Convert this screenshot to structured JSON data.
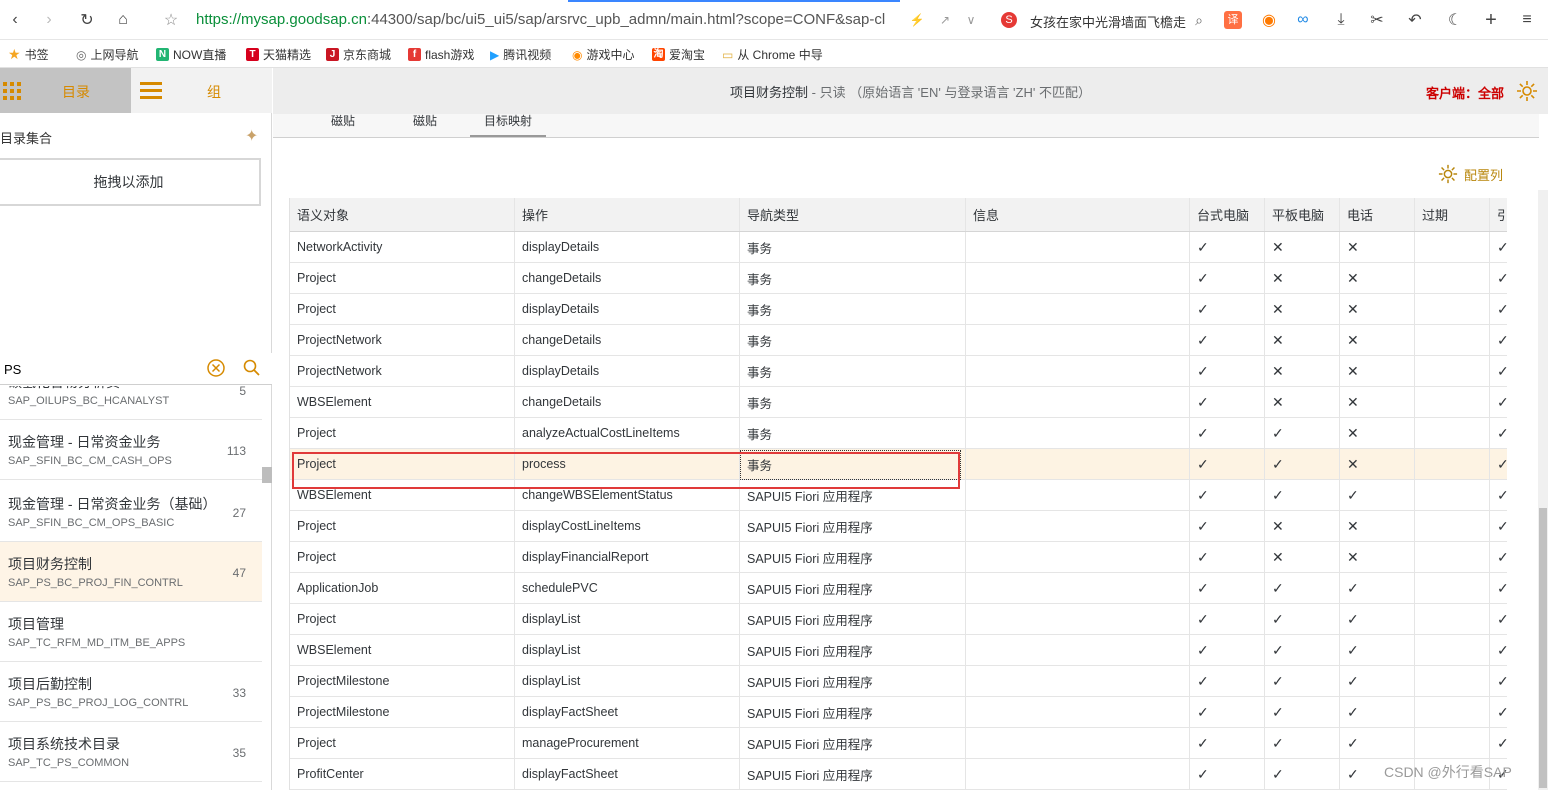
{
  "browser": {
    "url_scheme": "https://",
    "url_host": "mysap.goodsap.cn",
    "url_rest": ":44300/sap/bc/ui5_ui5/sap/arsrvc_upb_admn/main.html?scope=CONF&sap-cl",
    "news_text": "女孩在家中光滑墙面飞檐走",
    "bookmarks": [
      "书签",
      "上网导航",
      "NOW直播",
      "天猫精选",
      "京东商城",
      "flash游戏",
      "腾讯视频",
      "游戏中心",
      "爱淘宝",
      "从 Chrome 中导"
    ]
  },
  "left": {
    "tab_catalog": "目录",
    "tab_group": "组",
    "section_title": "目录集合",
    "drop_label": "拖拽以添加",
    "search_value": "PS",
    "catalogs": [
      {
        "title": "碳氢化合物分析员",
        "id": "SAP_OILUPS_BC_HCANALYST",
        "count": "5"
      },
      {
        "title": "现金管理 - 日常资金业务",
        "id": "SAP_SFIN_BC_CM_CASH_OPS",
        "count": "113"
      },
      {
        "title": "现金管理 - 日常资金业务（基础）",
        "id": "SAP_SFIN_BC_CM_OPS_BASIC",
        "count": "27"
      },
      {
        "title": "项目财务控制",
        "id": "SAP_PS_BC_PROJ_FIN_CONTRL",
        "count": "47"
      },
      {
        "title": "项目管理",
        "id": "SAP_TC_RFM_MD_ITM_BE_APPS",
        "count": ""
      },
      {
        "title": "项目后勤控制",
        "id": "SAP_PS_BC_PROJ_LOG_CONTRL",
        "count": "33"
      },
      {
        "title": "项目系统技术目录",
        "id": "SAP_TC_PS_COMMON",
        "count": "35"
      }
    ]
  },
  "header": {
    "title": "项目财务控制",
    "subtitle": " - 只读 （原始语言 'EN' 与登录语言 'ZH' 不匹配）",
    "client": "客户端：全部"
  },
  "subtabs": [
    "磁贴",
    "磁贴",
    "目标映射"
  ],
  "config_label": "配置列",
  "table": {
    "columns": [
      "语义对象",
      "操作",
      "导航类型",
      "信息",
      "台式电脑",
      "平板电脑",
      "电话",
      "过期",
      "引"
    ],
    "rows": [
      {
        "obj": "NetworkActivity",
        "action": "displayDetails",
        "nav": "事务",
        "desk": "y",
        "tab": "n",
        "phone": "n",
        "last": "y"
      },
      {
        "obj": "Project",
        "action": "changeDetails",
        "nav": "事务",
        "desk": "y",
        "tab": "n",
        "phone": "n",
        "last": "y"
      },
      {
        "obj": "Project",
        "action": "displayDetails",
        "nav": "事务",
        "desk": "y",
        "tab": "n",
        "phone": "n",
        "last": "y"
      },
      {
        "obj": "ProjectNetwork",
        "action": "changeDetails",
        "nav": "事务",
        "desk": "y",
        "tab": "n",
        "phone": "n",
        "last": "y"
      },
      {
        "obj": "ProjectNetwork",
        "action": "displayDetails",
        "nav": "事务",
        "desk": "y",
        "tab": "n",
        "phone": "n",
        "last": "y"
      },
      {
        "obj": "WBSElement",
        "action": "changeDetails",
        "nav": "事务",
        "desk": "y",
        "tab": "n",
        "phone": "n",
        "last": "y"
      },
      {
        "obj": "Project",
        "action": "analyzeActualCostLineItems",
        "nav": "事务",
        "desk": "y",
        "tab": "y",
        "phone": "n",
        "last": "y"
      },
      {
        "obj": "Project",
        "action": "process",
        "nav": "事务",
        "desk": "y",
        "tab": "y",
        "phone": "n",
        "last": "y"
      },
      {
        "obj": "WBSElement",
        "action": "changeWBSElementStatus",
        "nav": "SAPUI5 Fiori 应用程序",
        "desk": "y",
        "tab": "y",
        "phone": "y",
        "last": "y"
      },
      {
        "obj": "Project",
        "action": "displayCostLineItems",
        "nav": "SAPUI5 Fiori 应用程序",
        "desk": "y",
        "tab": "n",
        "phone": "n",
        "last": "y"
      },
      {
        "obj": "Project",
        "action": "displayFinancialReport",
        "nav": "SAPUI5 Fiori 应用程序",
        "desk": "y",
        "tab": "n",
        "phone": "n",
        "last": "y"
      },
      {
        "obj": "ApplicationJob",
        "action": "schedulePVC",
        "nav": "SAPUI5 Fiori 应用程序",
        "desk": "y",
        "tab": "y",
        "phone": "y",
        "last": "y"
      },
      {
        "obj": "Project",
        "action": "displayList",
        "nav": "SAPUI5 Fiori 应用程序",
        "desk": "y",
        "tab": "y",
        "phone": "y",
        "last": "y"
      },
      {
        "obj": "WBSElement",
        "action": "displayList",
        "nav": "SAPUI5 Fiori 应用程序",
        "desk": "y",
        "tab": "y",
        "phone": "y",
        "last": "y"
      },
      {
        "obj": "ProjectMilestone",
        "action": "displayList",
        "nav": "SAPUI5 Fiori 应用程序",
        "desk": "y",
        "tab": "y",
        "phone": "y",
        "last": "y"
      },
      {
        "obj": "ProjectMilestone",
        "action": "displayFactSheet",
        "nav": "SAPUI5 Fiori 应用程序",
        "desk": "y",
        "tab": "y",
        "phone": "y",
        "last": "y"
      },
      {
        "obj": "Project",
        "action": "manageProcurement",
        "nav": "SAPUI5 Fiori 应用程序",
        "desk": "y",
        "tab": "y",
        "phone": "y",
        "last": "y"
      },
      {
        "obj": "ProfitCenter",
        "action": "displayFactSheet",
        "nav": "SAPUI5 Fiori 应用程序",
        "desk": "y",
        "tab": "y",
        "phone": "y",
        "last": "y"
      }
    ]
  },
  "watermark": "CSDN @外行看SAP",
  "colors": {
    "accent": "#b8860b",
    "highlight_border": "#e03a3a",
    "client_red": "#cc0000"
  }
}
